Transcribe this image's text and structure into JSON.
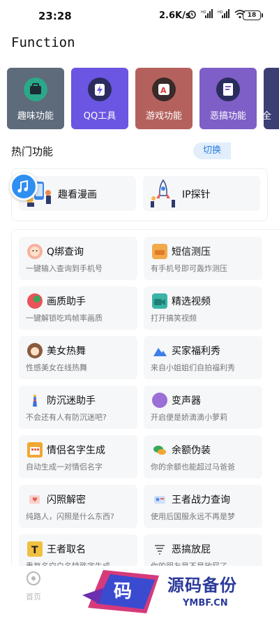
{
  "status": {
    "time": "23:28",
    "speed": "2.6K/s",
    "battery": "18"
  },
  "appbar": {
    "title": "Function"
  },
  "categories": [
    {
      "label": "趣味功能",
      "color": "#5d6b7a",
      "icon": "briefcase-icon"
    },
    {
      "label": "QQ工具",
      "color": "#6b55e3",
      "icon": "lightning-icon"
    },
    {
      "label": "游戏功能",
      "color": "#b4615d",
      "icon": "game-icon"
    },
    {
      "label": "恶搞功能",
      "color": "#7e5ec7",
      "icon": "note-icon"
    },
    {
      "label": "全",
      "color": "#3b3f74",
      "icon": "more-icon"
    }
  ],
  "hot": {
    "title": "热门功能",
    "switch_label": "切换",
    "items": [
      {
        "label": "趣看漫画",
        "icon": "comic-icon"
      },
      {
        "label": "IP探针",
        "icon": "rocket-icon"
      }
    ]
  },
  "functions": [
    {
      "title": "Q绑查询",
      "subtitle": "一键输入查询到手机号",
      "icon": "lion-icon",
      "color": "#f28a8a"
    },
    {
      "title": "短信测压",
      "subtitle": "有手机号即可轰炸测压",
      "icon": "sofa-icon",
      "color": "#f2a94a"
    },
    {
      "title": "画质助手",
      "subtitle": "一键解锁吃鸡帧率画质",
      "icon": "balloon-icon",
      "color": "#e9535a"
    },
    {
      "title": "精选视频",
      "subtitle": "打开搞笑视频",
      "icon": "video-camera-icon",
      "color": "#3bb3a6"
    },
    {
      "title": "美女热舞",
      "subtitle": "性感美女在线热舞",
      "icon": "girl-icon",
      "color": "#8b5a3c"
    },
    {
      "title": "买家福利秀",
      "subtitle": "来自小姐姐们自拍福利秀",
      "icon": "mountain-icon",
      "color": "#3d7ee8"
    },
    {
      "title": "防沉迷助手",
      "subtitle": "不会还有人有防沉迷吧?",
      "icon": "lighthouse-icon",
      "color": "#3d6fd8"
    },
    {
      "title": "变声器",
      "subtitle": "开启便是娇滴滴小萝莉",
      "icon": "eggplant-icon",
      "color": "#9b6fd6"
    },
    {
      "title": "情侣名字生成",
      "subtitle": "自动生成一对情侣名字",
      "icon": "calendar-icon",
      "color": "#f0a832"
    },
    {
      "title": "余额伪装",
      "subtitle": "你的余额也能超过马爸爸",
      "icon": "chat-bubbles-icon",
      "color": "#3aa85a"
    },
    {
      "title": "闪照解密",
      "subtitle": "纯路人，闪照是什么东西?",
      "icon": "photo-icon",
      "color": "#e8615a"
    },
    {
      "title": "王者战力查询",
      "subtitle": "使用后国服永远不再是梦",
      "icon": "king-card-icon",
      "color": "#5a8de8"
    },
    {
      "title": "王者取名",
      "subtitle": "重复名空白名特殊字生成",
      "icon": "text-t-icon",
      "color": "#f0c040"
    },
    {
      "title": "恶搞放屁",
      "subtitle": "你的朋友是不是放屁了",
      "icon": "tornado-icon",
      "color": "#888888"
    }
  ],
  "bottom_nav": {
    "home_label": "首页"
  },
  "watermark": {
    "seal": "码",
    "main": "源码备份",
    "sub": "YMBF.CN"
  }
}
